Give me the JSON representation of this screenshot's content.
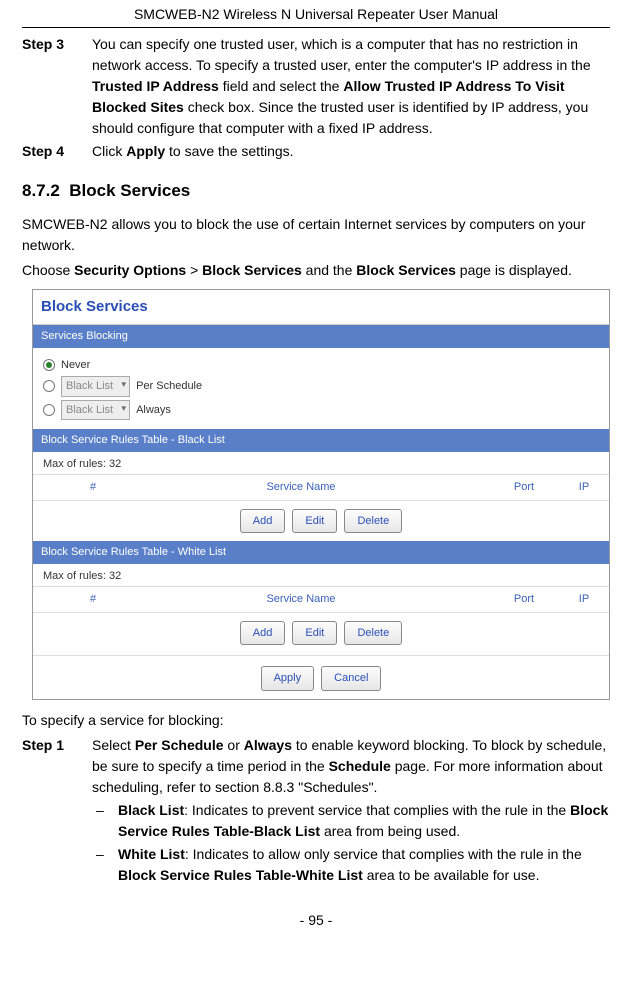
{
  "header": {
    "title": "SMCWEB-N2 Wireless N Universal Repeater User Manual"
  },
  "steps_top": [
    {
      "label": "Step 3",
      "text_parts": [
        "You can specify one trusted user, which is a computer that has no restriction in network access. To specify a trusted user, enter the computer's IP address in the ",
        "Trusted IP Address",
        " field and select the ",
        "Allow Trusted IP Address To Visit Blocked Sites",
        " check box. Since the trusted user is identified by IP address, you should configure that computer with a fixed IP address."
      ]
    },
    {
      "label": "Step 4",
      "text_parts": [
        "Click ",
        "Apply",
        " to save the settings."
      ]
    }
  ],
  "section": {
    "number": "8.7.2",
    "title": "Block Services"
  },
  "intro": [
    {
      "plain": "SMCWEB-N2 allows you to block the use of certain Internet services by computers on your network."
    },
    {
      "parts": [
        "Choose ",
        "Security Options",
        " > ",
        "Block Services",
        " and the ",
        "Block Services",
        " page is displayed."
      ]
    }
  ],
  "screenshot": {
    "title": "Block Services",
    "services_blocking": {
      "header": "Services Blocking",
      "options": [
        {
          "label": "Never",
          "checked": true,
          "select": null,
          "suffix": ""
        },
        {
          "label": "",
          "checked": false,
          "select": "Black List",
          "suffix": "Per Schedule"
        },
        {
          "label": "",
          "checked": false,
          "select": "Black List",
          "suffix": "Always"
        }
      ]
    },
    "tables": [
      {
        "header": "Block Service Rules Table - Black List",
        "max": "Max of rules: 32",
        "cols": [
          "",
          "#",
          "Service Name",
          "Port",
          "IP"
        ],
        "buttons": [
          "Add",
          "Edit",
          "Delete"
        ]
      },
      {
        "header": "Block Service Rules Table - White List",
        "max": "Max of rules: 32",
        "cols": [
          "",
          "#",
          "Service Name",
          "Port",
          "IP"
        ],
        "buttons": [
          "Add",
          "Edit",
          "Delete"
        ]
      }
    ],
    "footer_buttons": [
      "Apply",
      "Cancel"
    ]
  },
  "specify_intro": "To specify a service for blocking:",
  "steps_bottom": [
    {
      "label": "Step 1",
      "text_parts": [
        "Select ",
        "Per Schedule",
        " or ",
        "Always",
        " to enable keyword blocking. To block by schedule, be sure to specify a time period in the ",
        "Schedule",
        " page. For more information about scheduling, refer to section 8.8.3 \"Schedules\"."
      ]
    }
  ],
  "sublist": [
    {
      "dash": "–",
      "parts": [
        "Black List",
        ": Indicates to prevent service that complies with the rule in the ",
        "Block Service Rules Table-Black List",
        " area from being used."
      ]
    },
    {
      "dash": "–",
      "parts": [
        "White List",
        ": Indicates to allow only service that complies with the rule in the ",
        "Block Service Rules Table-White List",
        " area to be available for use."
      ]
    }
  ],
  "page_number": "- 95 -"
}
